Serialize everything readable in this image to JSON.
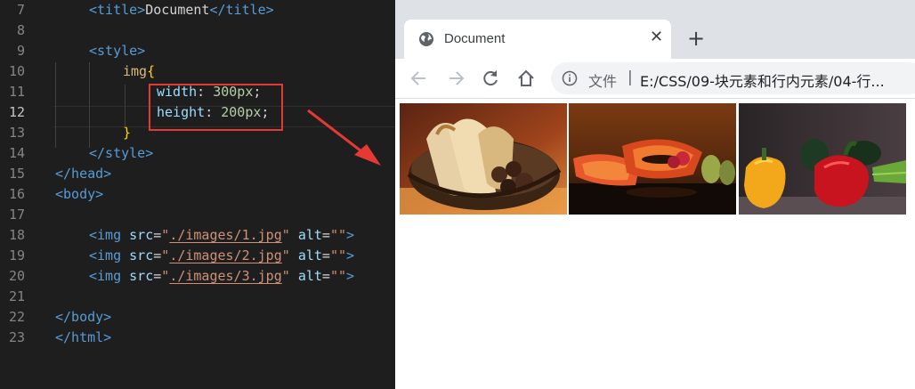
{
  "editor": {
    "lines": [
      {
        "num": "7",
        "tokens": [
          [
            "tag",
            "<title>"
          ],
          [
            "txt",
            "Document"
          ],
          [
            "tag",
            "</title>"
          ]
        ],
        "indent": 1
      },
      {
        "num": "8",
        "tokens": [],
        "indent": 0
      },
      {
        "num": "9",
        "tokens": [
          [
            "tag",
            "<style>"
          ]
        ],
        "indent": 1
      },
      {
        "num": "10",
        "tokens": [
          [
            "sel",
            "img"
          ],
          [
            "brace",
            "{"
          ]
        ],
        "indent": 2
      },
      {
        "num": "11",
        "tokens": [
          [
            "prop",
            "width"
          ],
          [
            "txt",
            ": "
          ],
          [
            "num",
            "300px"
          ],
          [
            "txt",
            ";"
          ]
        ],
        "indent": 3
      },
      {
        "num": "12",
        "tokens": [
          [
            "prop",
            "height"
          ],
          [
            "txt",
            ": "
          ],
          [
            "num",
            "200px"
          ],
          [
            "txt",
            ";"
          ]
        ],
        "indent": 3,
        "active": true
      },
      {
        "num": "13",
        "tokens": [
          [
            "brace",
            "}"
          ]
        ],
        "indent": 2
      },
      {
        "num": "14",
        "tokens": [
          [
            "tag",
            "</style>"
          ]
        ],
        "indent": 1
      },
      {
        "num": "15",
        "tokens": [
          [
            "tag",
            "</head>"
          ]
        ],
        "indent": 0
      },
      {
        "num": "16",
        "tokens": [
          [
            "tag",
            "<body>"
          ]
        ],
        "indent": 0
      },
      {
        "num": "17",
        "tokens": [],
        "indent": 0
      },
      {
        "num": "18",
        "tokens": [
          [
            "tag",
            "<img "
          ],
          [
            "attr",
            "src"
          ],
          [
            "txt",
            "="
          ],
          [
            "str",
            "\""
          ],
          [
            "strU",
            "./images/1.jpg"
          ],
          [
            "str",
            "\""
          ],
          [
            "txt",
            " "
          ],
          [
            "attr",
            "alt"
          ],
          [
            "txt",
            "="
          ],
          [
            "str",
            "\"\""
          ],
          [
            "tag",
            ">"
          ]
        ],
        "indent": 1
      },
      {
        "num": "19",
        "tokens": [
          [
            "tag",
            "<img "
          ],
          [
            "attr",
            "src"
          ],
          [
            "txt",
            "="
          ],
          [
            "str",
            "\""
          ],
          [
            "strU",
            "./images/2.jpg"
          ],
          [
            "str",
            "\""
          ],
          [
            "txt",
            " "
          ],
          [
            "attr",
            "alt"
          ],
          [
            "txt",
            "="
          ],
          [
            "str",
            "\"\""
          ],
          [
            "tag",
            ">"
          ]
        ],
        "indent": 1
      },
      {
        "num": "20",
        "tokens": [
          [
            "tag",
            "<img "
          ],
          [
            "attr",
            "src"
          ],
          [
            "txt",
            "="
          ],
          [
            "str",
            "\""
          ],
          [
            "strU",
            "./images/3.jpg"
          ],
          [
            "str",
            "\""
          ],
          [
            "txt",
            " "
          ],
          [
            "attr",
            "alt"
          ],
          [
            "txt",
            "="
          ],
          [
            "str",
            "\"\""
          ],
          [
            "tag",
            ">"
          ]
        ],
        "indent": 1
      },
      {
        "num": "21",
        "tokens": [],
        "indent": 0
      },
      {
        "num": "22",
        "tokens": [
          [
            "tag",
            "</body>"
          ]
        ],
        "indent": 0
      },
      {
        "num": "23",
        "tokens": [
          [
            "tag",
            "</html>"
          ]
        ],
        "indent": 0
      }
    ]
  },
  "browser": {
    "tab_title": "Document",
    "tab_close": "✕",
    "new_tab": "+",
    "url_scheme": "文件",
    "url_sep": "|",
    "url": "E:/CSS/09-块元素和行内元素/04-行...",
    "images": [
      {
        "name": "bread-basket-photo",
        "alt": ""
      },
      {
        "name": "papaya-fruit-photo",
        "alt": ""
      },
      {
        "name": "bell-peppers-photo",
        "alt": ""
      }
    ]
  },
  "colors": {
    "editor_bg": "#1e1e1e",
    "highlight_red": "#e53935",
    "tab_strip": "#dee1e6"
  }
}
